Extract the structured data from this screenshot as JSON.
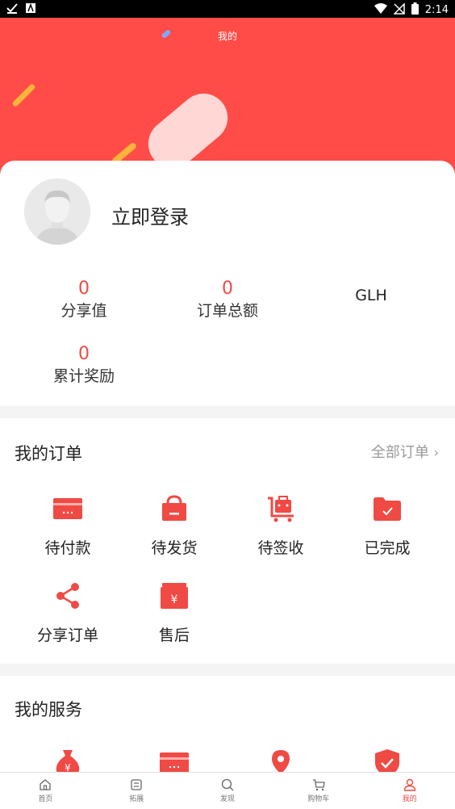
{
  "status_bar": {
    "time": "2:14"
  },
  "header": {
    "title": "我的"
  },
  "profile": {
    "login_label": "立即登录",
    "stats": [
      {
        "value": "0",
        "label": "分享值"
      },
      {
        "value": "0",
        "label": "订单总额"
      },
      {
        "value": "0",
        "label": "累计奖励"
      }
    ],
    "extra_label": "GLH"
  },
  "orders": {
    "title": "我的订单",
    "all_label": "全部订单",
    "items": [
      {
        "label": "待付款",
        "icon": "wallet-icon"
      },
      {
        "label": "待发货",
        "icon": "shopping-bag-icon"
      },
      {
        "label": "待签收",
        "icon": "delivery-cart-icon"
      },
      {
        "label": "已完成",
        "icon": "folder-check-icon"
      },
      {
        "label": "分享订单",
        "icon": "share-icon"
      },
      {
        "label": "售后",
        "icon": "after-sales-icon"
      }
    ]
  },
  "services": {
    "title": "我的服务",
    "items": [
      {
        "icon": "money-bag-icon"
      },
      {
        "icon": "card-icon"
      },
      {
        "icon": "location-pin-icon"
      },
      {
        "icon": "shield-check-icon"
      }
    ]
  },
  "tab_bar": {
    "items": [
      {
        "label": "首页",
        "icon": "home-icon"
      },
      {
        "label": "拓展",
        "icon": "list-icon"
      },
      {
        "label": "发现",
        "icon": "search-icon"
      },
      {
        "label": "购物车",
        "icon": "cart-icon"
      },
      {
        "label": "我的",
        "icon": "user-icon"
      }
    ],
    "active_index": 4
  },
  "colors": {
    "accent": "#f04a44",
    "header": "#ff4c48"
  }
}
